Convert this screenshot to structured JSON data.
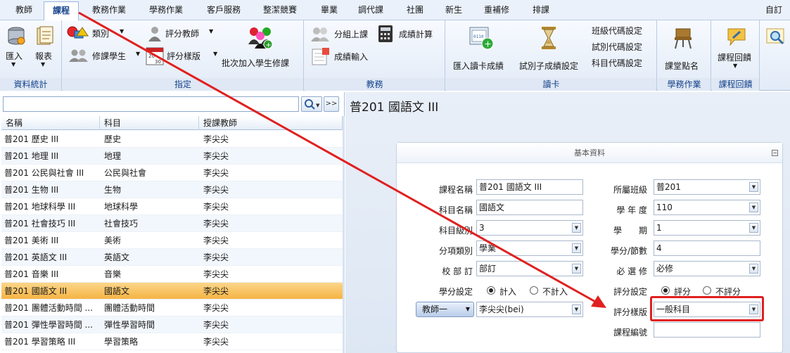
{
  "menu": {
    "tabs": [
      "教師",
      "課程",
      "教務作業",
      "學務作業",
      "客戶服務",
      "整潔競賽",
      "畢業",
      "調代課",
      "社團",
      "新生",
      "重補修",
      "排課"
    ],
    "active_tab": "課程",
    "right_label": "自訂"
  },
  "ribbon": {
    "groups": [
      {
        "label": "資料統計",
        "buttons": [
          "匯入",
          "報表"
        ]
      },
      {
        "label": "指定",
        "buttons": [
          "類別",
          "修課學生",
          "評分教師",
          "評分樣版",
          "批次加入學生修課"
        ]
      },
      {
        "label": "教務",
        "buttons": [
          "分組上課",
          "成績計算",
          "成績輸入"
        ]
      },
      {
        "label": "讀卡",
        "buttons": [
          "匯入讀卡成績",
          "試別子成績設定",
          "班級代碼設定",
          "試別代碼設定",
          "科目代碼設定"
        ]
      },
      {
        "label": "學務作業",
        "buttons": [
          "課堂點名"
        ]
      },
      {
        "label": "課程回饋",
        "buttons": [
          "課程回饋"
        ]
      }
    ]
  },
  "left": {
    "search_value": "",
    "more_label": ">>",
    "columns": [
      "名稱",
      "科目",
      "授課教師"
    ],
    "rows": [
      {
        "name": "普201 歷史 III",
        "subject": "歷史",
        "teacher": "李尖尖"
      },
      {
        "name": "普201 地理 III",
        "subject": "地理",
        "teacher": "李尖尖"
      },
      {
        "name": "普201 公民與社會 III",
        "subject": "公民與社會",
        "teacher": "李尖尖"
      },
      {
        "name": "普201 生物 III",
        "subject": "生物",
        "teacher": "李尖尖"
      },
      {
        "name": "普201 地球科學 III",
        "subject": "地球科學",
        "teacher": "李尖尖"
      },
      {
        "name": "普201 社會技巧 III",
        "subject": "社會技巧",
        "teacher": "李尖尖"
      },
      {
        "name": "普201 美術 III",
        "subject": "美術",
        "teacher": "李尖尖"
      },
      {
        "name": "普201 英語文 III",
        "subject": "英語文",
        "teacher": "李尖尖"
      },
      {
        "name": "普201 音樂 III",
        "subject": "音樂",
        "teacher": "李尖尖"
      },
      {
        "name": "普201 國語文 III",
        "subject": "國語文",
        "teacher": "李尖尖"
      },
      {
        "name": "普201 團體活動時間 ...",
        "subject": "團體活動時間",
        "teacher": "李尖尖"
      },
      {
        "name": "普201 彈性學習時間 ...",
        "subject": "彈性學習時間",
        "teacher": "李尖尖"
      },
      {
        "name": "普201 學習策略 III",
        "subject": "學習策略",
        "teacher": "李尖尖"
      }
    ],
    "selected_index": 9
  },
  "detail": {
    "title": "普201  國語文 III",
    "panel_title": "基本資料",
    "collapse_label": "⊟",
    "fields": {
      "course_name": {
        "label": "課程名稱",
        "value": "普201 國語文 III"
      },
      "subject_name": {
        "label": "科目名稱",
        "value": "國語文"
      },
      "subject_level": {
        "label": "科目級別",
        "value": "3"
      },
      "category": {
        "label": "分項類別",
        "value": "學業"
      },
      "required_by": {
        "label": "校 部 訂",
        "value": "部訂"
      },
      "credit_setting": {
        "label": "學分設定",
        "options": [
          "計入",
          "不計入"
        ],
        "selected": "計入"
      },
      "teacher_button": "教師一",
      "teacher": {
        "value": "李尖尖(bei)"
      },
      "class": {
        "label": "所屬班級",
        "value": "普201"
      },
      "school_year": {
        "label": "學 年 度",
        "value": "110"
      },
      "semester": {
        "label": "學　　期",
        "value": "1"
      },
      "credits": {
        "label": "學分/節數",
        "value": "4"
      },
      "required_type": {
        "label": "必 選 修",
        "value": "必修"
      },
      "score_setting": {
        "label": "評分設定",
        "options": [
          "評分",
          "不評分"
        ],
        "selected": "評分"
      },
      "score_template": {
        "label": "評分樣版",
        "value": "一般科目"
      },
      "course_code": {
        "label": "課程編號",
        "value": ""
      }
    }
  },
  "colors": {
    "selected_row": "#f5b444",
    "annotation": "#e02020",
    "ribbon_label": "#15428b"
  }
}
